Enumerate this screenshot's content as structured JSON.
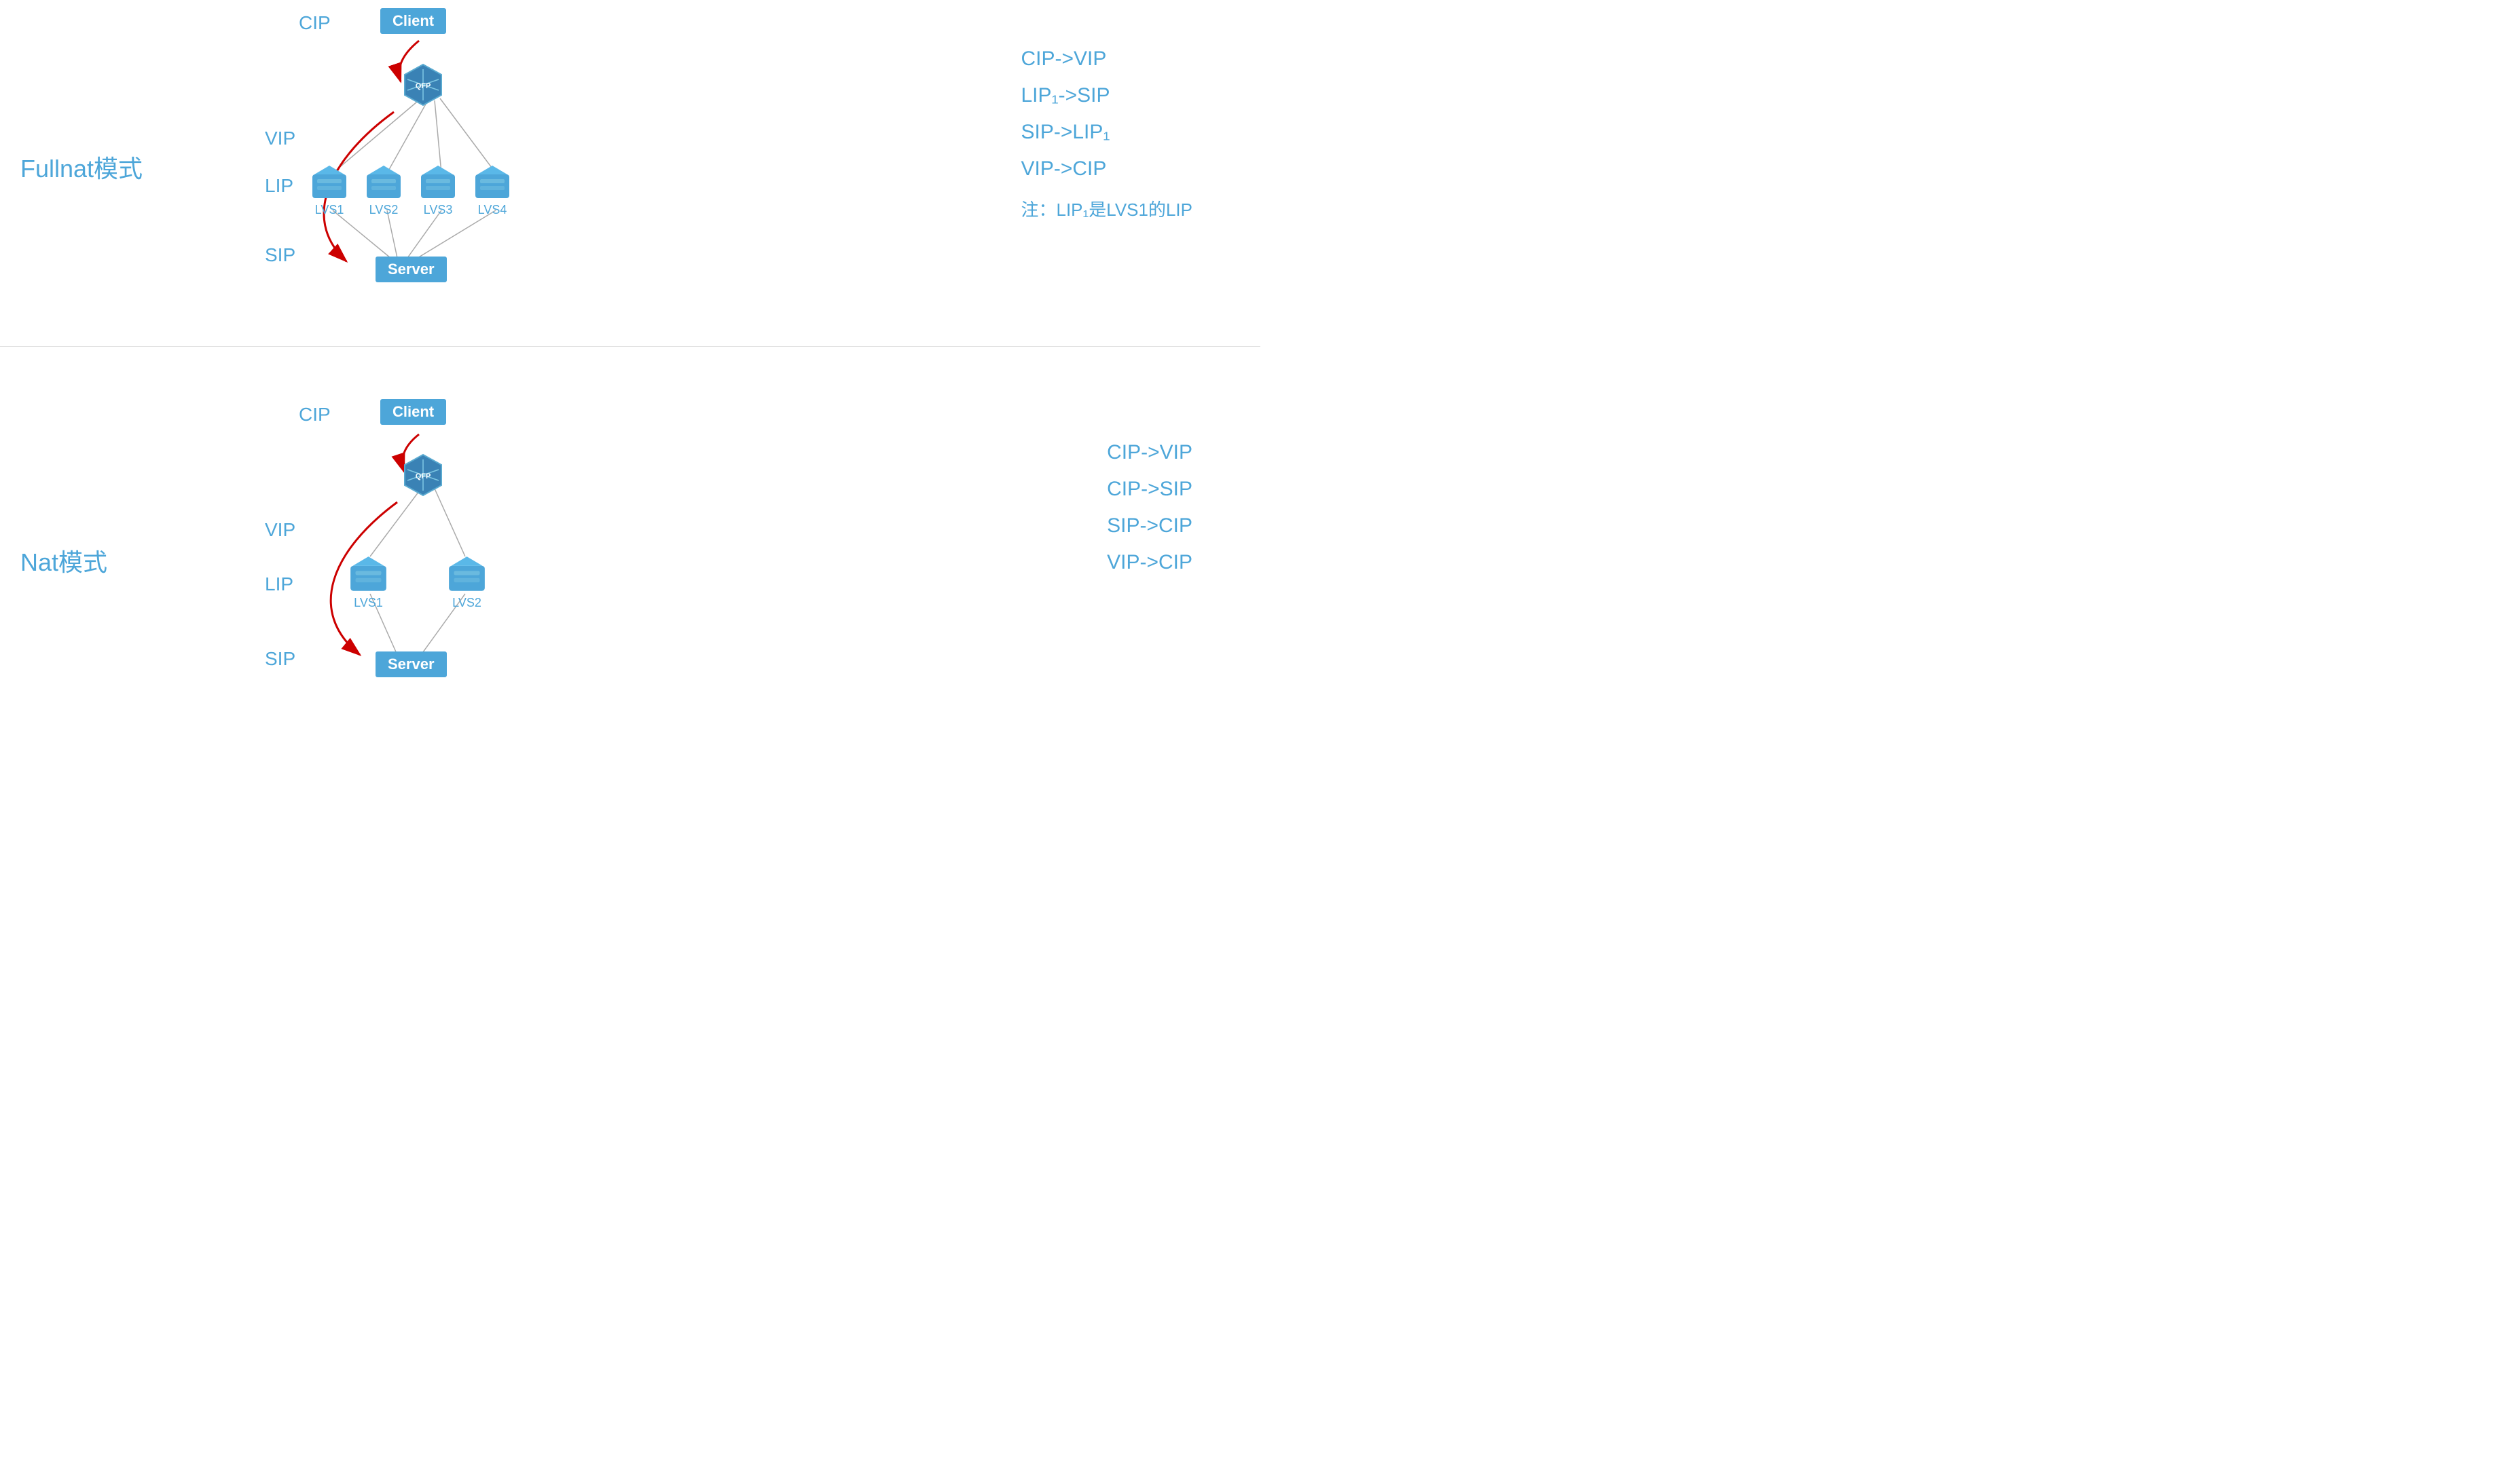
{
  "fullnat": {
    "section_label": "Fullnat模式",
    "ip_labels": {
      "cip": "CIP",
      "vip": "VIP",
      "lip": "LIP",
      "sip": "SIP"
    },
    "client_label": "Client",
    "server_label": "Server",
    "qfp_label": "QFP",
    "lvs_nodes": [
      "LVS1",
      "LVS2",
      "LVS3",
      "LVS4"
    ],
    "info_lines": [
      "CIP->VIP",
      "LIP₁->SIP",
      "SIP->LIP₁",
      "VIP->CIP"
    ],
    "note": "注：LIP₁是LVS1的LIP"
  },
  "nat": {
    "section_label": "Nat模式",
    "ip_labels": {
      "cip": "CIP",
      "vip": "VIP",
      "lip": "LIP",
      "sip": "SIP"
    },
    "client_label": "Client",
    "server_label": "Server",
    "qfp_label": "QFP",
    "lvs_nodes": [
      "LVS1",
      "LVS2"
    ],
    "info_lines": [
      "CIP->VIP",
      "CIP->SIP",
      "SIP->CIP",
      "VIP->CIP"
    ]
  }
}
